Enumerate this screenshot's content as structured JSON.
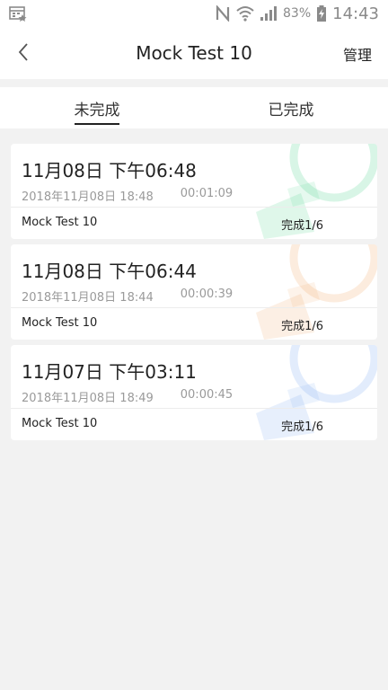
{
  "status_bar": {
    "battery": "83%",
    "time": "14:43"
  },
  "nav": {
    "title": "Mock Test 10",
    "manage_label": "管理"
  },
  "tabs": [
    {
      "label": "未完成",
      "active": true
    },
    {
      "label": "已完成",
      "active": false
    }
  ],
  "records": [
    {
      "title": "11月08日 下午06:48",
      "datetime": "2018年11月08日 18:48",
      "duration": "00:01:09",
      "test_name": "Mock Test 10",
      "progress": "完成1/6",
      "accent": "#4fd28c"
    },
    {
      "title": "11月08日 下午06:44",
      "datetime": "2018年11月08日 18:44",
      "duration": "00:00:39",
      "test_name": "Mock Test 10",
      "progress": "完成1/6",
      "accent": "#f0a86a"
    },
    {
      "title": "11月07日 下午03:11",
      "datetime": "2018年11月08日 18:49",
      "duration": "00:00:45",
      "test_name": "Mock Test 10",
      "progress": "完成1/6",
      "accent": "#7aa7f0"
    }
  ]
}
